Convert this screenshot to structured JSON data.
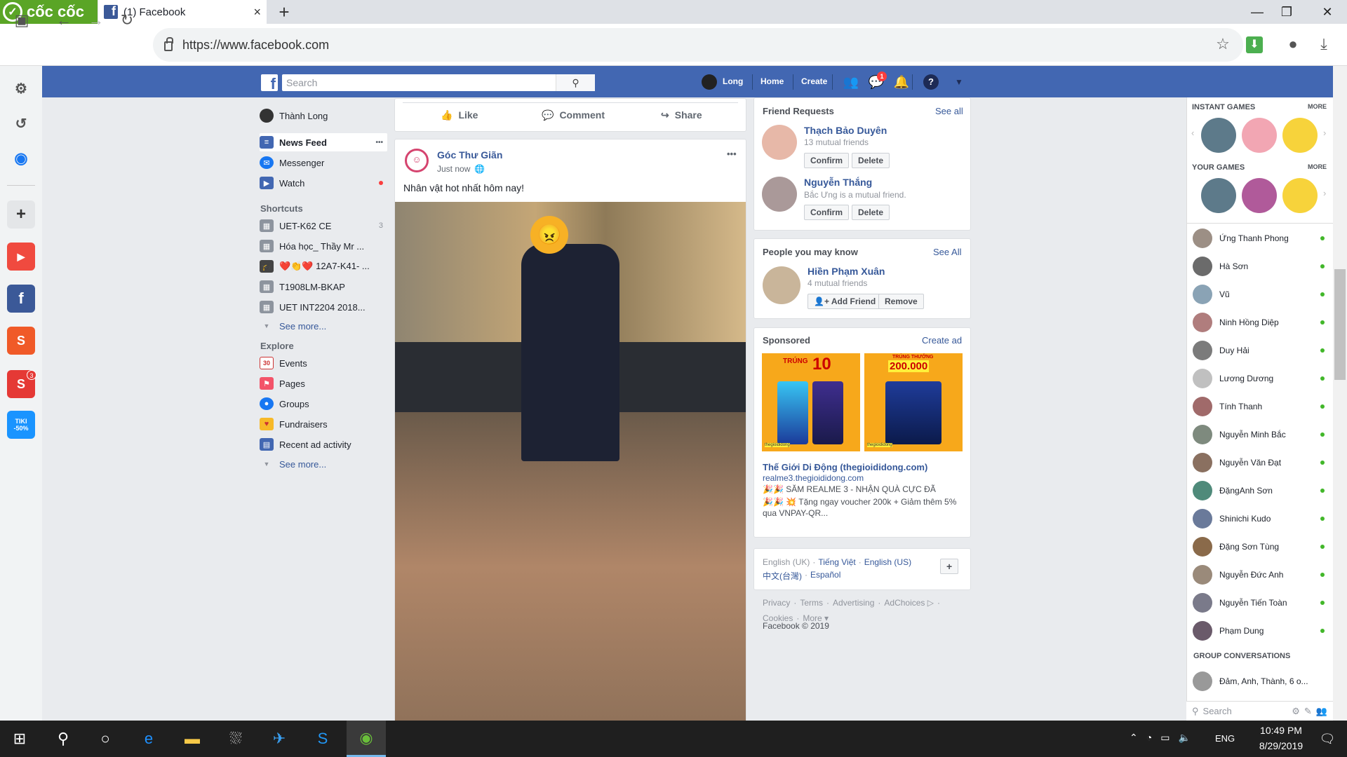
{
  "browser": {
    "brand": "cốc cốc",
    "tab_title": "(1) Facebook",
    "tab_close": "×",
    "new_tab": "+",
    "url": "https://www.facebook.com",
    "window": {
      "min": "—",
      "max": "❐",
      "close": "✕"
    }
  },
  "browser_sidebar": {
    "items": [
      {
        "icon": "sidebar-toggle-icon"
      },
      {
        "icon": "settings-gear-icon"
      },
      {
        "icon": "history-icon"
      },
      {
        "icon": "messenger-icon"
      },
      {
        "icon": "add-icon"
      },
      {
        "icon": "youtube-icon"
      },
      {
        "icon": "facebook-icon"
      },
      {
        "icon": "shopee-icon",
        "badge": ""
      },
      {
        "icon": "sendo-icon",
        "badge": "3"
      },
      {
        "icon": "tiki-icon",
        "label": "TIKI -50%"
      }
    ]
  },
  "fb_header": {
    "search_placeholder": "Search",
    "user": "Long",
    "home": "Home",
    "create": "Create",
    "messenger_badge": "1"
  },
  "left_nav": {
    "profile": "Thành Long",
    "main": [
      {
        "label": "News Feed",
        "more": "•••"
      },
      {
        "label": "Messenger"
      },
      {
        "label": "Watch"
      }
    ],
    "shortcuts_title": "Shortcuts",
    "shortcuts": [
      {
        "label": "UET-K62 CE",
        "count": "3"
      },
      {
        "label": "Hóa học_ Thầy Mr ..."
      },
      {
        "label": "❤️👏❤️ 12A7-K41- ..."
      },
      {
        "label": "T1908LM-BKAP"
      },
      {
        "label": "UET INT2204 2018..."
      }
    ],
    "see_more": "See more...",
    "explore_title": "Explore",
    "explore": [
      {
        "label": "Events",
        "icon": "30"
      },
      {
        "label": "Pages"
      },
      {
        "label": "Groups"
      },
      {
        "label": "Fundraisers"
      },
      {
        "label": "Recent ad activity"
      }
    ],
    "see_more_2": "See more..."
  },
  "feed": {
    "actions": {
      "like": "Like",
      "comment": "Comment",
      "share": "Share"
    },
    "post": {
      "author": "Góc Thư Giãn",
      "time": "Just now",
      "privacy_icon": "globe-icon",
      "options": "•••",
      "text": "Nhân vật hot nhất hôm nay!"
    }
  },
  "friend_requests": {
    "title": "Friend Requests",
    "see_all": "See all",
    "items": [
      {
        "name": "Thạch Bảo Duyên",
        "meta": "13 mutual friends",
        "confirm": "Confirm",
        "delete": "Delete"
      },
      {
        "name": "Nguyễn Thắng",
        "meta": "Bắc Ưng is a mutual friend.",
        "confirm": "Confirm",
        "delete": "Delete"
      }
    ]
  },
  "pymk": {
    "title": "People you may know",
    "see_all": "See All",
    "name": "Hiền Phạm Xuân",
    "meta": "4 mutual friends",
    "add": "Add Friend",
    "remove": "Remove"
  },
  "sponsored": {
    "title": "Sponsored",
    "create_ad": "Create ad",
    "ad1_big": "10",
    "ad1_top": "TRÚNG",
    "ad2_big": "200.000",
    "ad2_top": "TRÚNG THƯỞNG",
    "brand": "thegioididong",
    "advertiser": "Thế Giới Di Động (thegioididong.com)",
    "domain": "realme3.thegioididong.com",
    "line1": "🎉🎉 SĂM REALME 3 - NHẬN QUÀ CỰC ĐÃ",
    "line2": "🎉🎉 💥 Tặng ngay voucher 200k + Giảm thêm 5% qua VNPAY-QR..."
  },
  "languages": {
    "items": [
      "English (UK)",
      "Tiếng Việt",
      "English (US)",
      "中文(台灣)",
      "Español"
    ],
    "add": "+"
  },
  "footer": {
    "links": [
      "Privacy",
      "Terms",
      "Advertising",
      "AdChoices ▷",
      "Cookies",
      "More ▾"
    ],
    "copyright": "Facebook © 2019"
  },
  "chat": {
    "instant_games": "INSTANT GAMES",
    "more1": "MORE",
    "your_games": "YOUR GAMES",
    "more2": "MORE",
    "contacts": [
      "Ứng Thanh Phong",
      "Hà Sơn",
      "Vũ",
      "Ninh Hồng Diệp",
      "Duy Hải",
      "Lương Dương",
      "Tính Thanh",
      "Nguyễn Minh Bắc",
      "Nguyễn Văn Đạt",
      "ĐặngAnh Sơn",
      "Shinichi Kudo",
      "Đặng Sơn Tùng",
      "Nguyễn Đức Anh",
      "Nguyễn Tiến Toàn",
      "Phạm Dung"
    ],
    "group_title": "GROUP CONVERSATIONS",
    "group": "Đảm, Anh, Thành, 6 o...",
    "search": "Search"
  },
  "taskbar": {
    "lang": "ENG",
    "time": "10:49 PM",
    "date": "8/29/2019"
  }
}
